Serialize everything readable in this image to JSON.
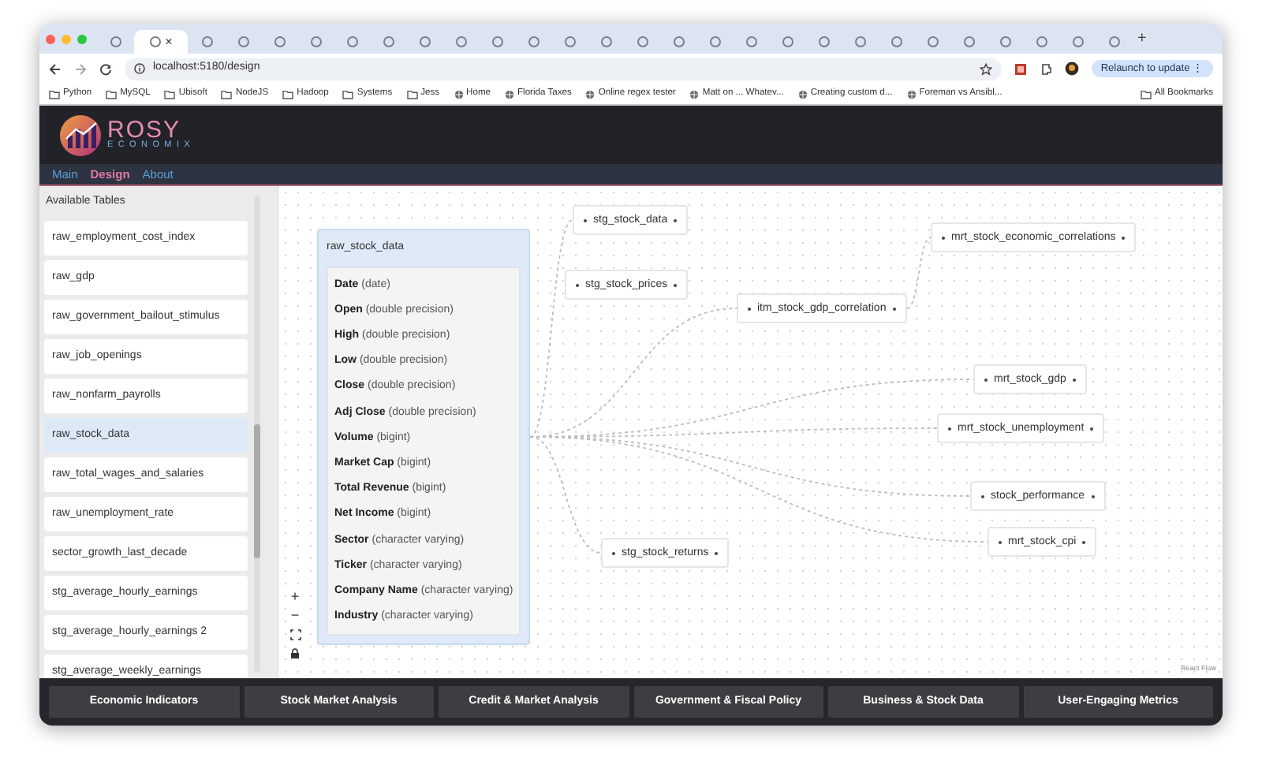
{
  "browser": {
    "tabs": [
      {
        "selected": false
      },
      {
        "selected": true,
        "close": "×"
      },
      {
        "selected": false
      },
      {
        "selected": false
      },
      {
        "selected": false
      },
      {
        "selected": false
      },
      {
        "selected": false
      },
      {
        "selected": false
      },
      {
        "selected": false
      },
      {
        "selected": false
      },
      {
        "selected": false
      },
      {
        "selected": false
      },
      {
        "selected": false
      },
      {
        "selected": false
      },
      {
        "selected": false
      },
      {
        "selected": false
      },
      {
        "selected": false
      },
      {
        "selected": false
      },
      {
        "selected": false
      },
      {
        "selected": false
      },
      {
        "selected": false
      },
      {
        "selected": false
      },
      {
        "selected": false
      },
      {
        "selected": false
      },
      {
        "selected": false
      },
      {
        "selected": false
      },
      {
        "selected": false
      },
      {
        "selected": false
      }
    ],
    "new_tab": "+",
    "url": "localhost:5180/design",
    "relaunch": "Relaunch to update",
    "menu": "⋮",
    "bookmarks": [
      {
        "kind": "folder",
        "label": "Python"
      },
      {
        "kind": "folder",
        "label": "MySQL"
      },
      {
        "kind": "folder",
        "label": "Ubisoft"
      },
      {
        "kind": "folder",
        "label": "NodeJS"
      },
      {
        "kind": "folder",
        "label": "Hadoop"
      },
      {
        "kind": "folder",
        "label": "Systems"
      },
      {
        "kind": "folder",
        "label": "Jess"
      },
      {
        "kind": "site",
        "label": "Home"
      },
      {
        "kind": "site",
        "label": "Florida Taxes"
      },
      {
        "kind": "site",
        "label": "Online regex tester"
      },
      {
        "kind": "site",
        "label": "Matt on ... Whatev..."
      },
      {
        "kind": "site",
        "label": "Creating custom d..."
      },
      {
        "kind": "site",
        "label": "Foreman vs Ansibl..."
      }
    ],
    "all_bookmarks": "All Bookmarks"
  },
  "app": {
    "logo": {
      "line_1": "ROSY",
      "line_2": "ECONOMIX"
    },
    "nav": [
      {
        "label": "Main",
        "selected": false
      },
      {
        "label": "Design",
        "selected": true
      },
      {
        "label": "About",
        "selected": false
      }
    ],
    "sidebar": {
      "title": "Available Tables",
      "items": [
        {
          "label": "raw_employment_cost_index",
          "selected": false
        },
        {
          "label": "raw_gdp",
          "selected": false
        },
        {
          "label": "raw_government_bailout_stimulus",
          "selected": false
        },
        {
          "label": "raw_job_openings",
          "selected": false
        },
        {
          "label": "raw_nonfarm_payrolls",
          "selected": false
        },
        {
          "label": "raw_stock_data",
          "selected": true
        },
        {
          "label": "raw_total_wages_and_salaries",
          "selected": false
        },
        {
          "label": "raw_unemployment_rate",
          "selected": false
        },
        {
          "label": "sector_growth_last_decade",
          "selected": false
        },
        {
          "label": "stg_average_hourly_earnings",
          "selected": false
        },
        {
          "label": "stg_average_hourly_earnings 2",
          "selected": false
        },
        {
          "label": "stg_average_weekly_earnings",
          "selected": false
        }
      ]
    },
    "diagram": {
      "nodes": [
        {
          "kind": "table",
          "title": "raw_stock_data",
          "fields": [
            {
              "name": "Date",
              "type": "(date)"
            },
            {
              "name": "Open",
              "type": "(double precision)"
            },
            {
              "name": "High",
              "type": "(double precision)"
            },
            {
              "name": "Low",
              "type": "(double precision)"
            },
            {
              "name": "Close",
              "type": "(double precision)"
            },
            {
              "name": "Adj Close",
              "type": "(double precision)"
            },
            {
              "name": "Volume",
              "type": "(bigint)"
            },
            {
              "name": "Market Cap",
              "type": "(bigint)"
            },
            {
              "name": "Total Revenue",
              "type": "(bigint)"
            },
            {
              "name": "Net Income",
              "type": "(bigint)"
            },
            {
              "name": "Sector",
              "type": "(character varying)"
            },
            {
              "name": "Ticker",
              "type": "(character varying)"
            },
            {
              "name": "Company Name",
              "type": "(character varying)"
            },
            {
              "name": "Industry",
              "type": "(character varying)"
            }
          ]
        },
        {
          "kind": "model",
          "title": "stg_stock_data"
        },
        {
          "kind": "model",
          "title": "stg_stock_prices"
        },
        {
          "kind": "model",
          "title": "itm_stock_gdp_correlation"
        },
        {
          "kind": "model",
          "title": "mrt_stock_economic_correlations"
        },
        {
          "kind": "model",
          "title": "mrt_stock_gdp"
        },
        {
          "kind": "model",
          "title": "mrt_stock_unemployment"
        },
        {
          "kind": "model",
          "title": "stock_performance"
        },
        {
          "kind": "model",
          "title": "mrt_stock_cpi"
        },
        {
          "kind": "model",
          "title": "stg_stock_returns"
        }
      ],
      "controls": [
        "+",
        "−"
      ],
      "attribution": "React Flow"
    },
    "footer": [
      "Economic Indicators",
      "Stock Market Analysis",
      "Credit & Market Analysis",
      "Government & Fiscal Policy",
      "Business & Stock Data",
      "User-Engaging Metrics"
    ]
  }
}
